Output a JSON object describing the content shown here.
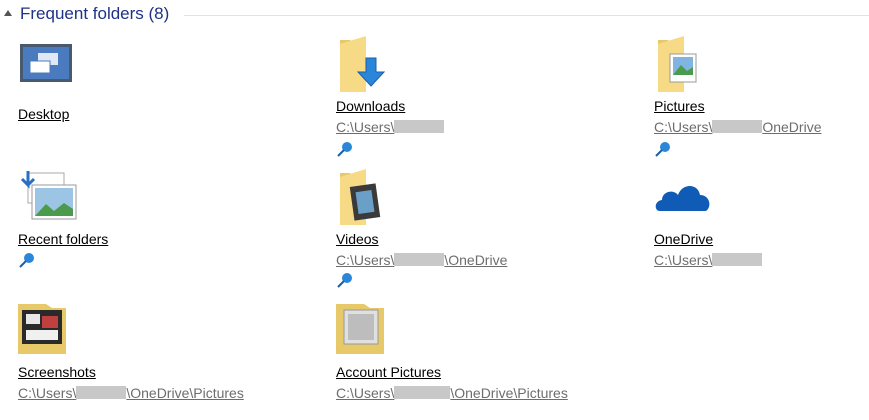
{
  "group": {
    "title": "Frequent folders (8)"
  },
  "items": [
    {
      "name": "Desktop",
      "path_prefix": "",
      "path_suffix": ""
    },
    {
      "name": "Downloads",
      "path_prefix": "C:\\Users\\",
      "path_suffix": ""
    },
    {
      "name": "Pictures",
      "path_prefix": "C:\\Users\\",
      "path_suffix": "OneDrive"
    },
    {
      "name": "Recent folders",
      "path_prefix": "",
      "path_suffix": ""
    },
    {
      "name": "Videos",
      "path_prefix": "C:\\Users\\",
      "path_suffix": "\\OneDrive"
    },
    {
      "name": "OneDrive",
      "path_prefix": "C:\\Users\\",
      "path_suffix": ""
    },
    {
      "name": "Screenshots",
      "path_prefix": "C:\\Users\\",
      "path_suffix": "\\OneDrive\\Pictures"
    },
    {
      "name": "Account Pictures",
      "path_prefix": "C:\\Users\\",
      "path_suffix": "\\OneDrive\\Pictures"
    }
  ],
  "icons": {
    "desktop": "desktop-icon",
    "downloads": "downloads-folder-icon",
    "pictures": "pictures-folder-icon",
    "recent": "recent-folders-icon",
    "videos": "videos-folder-icon",
    "onedrive": "onedrive-cloud-icon",
    "screenshots": "screenshots-folder-icon",
    "account_pictures": "account-pictures-folder-icon",
    "pin": "pin-icon"
  }
}
